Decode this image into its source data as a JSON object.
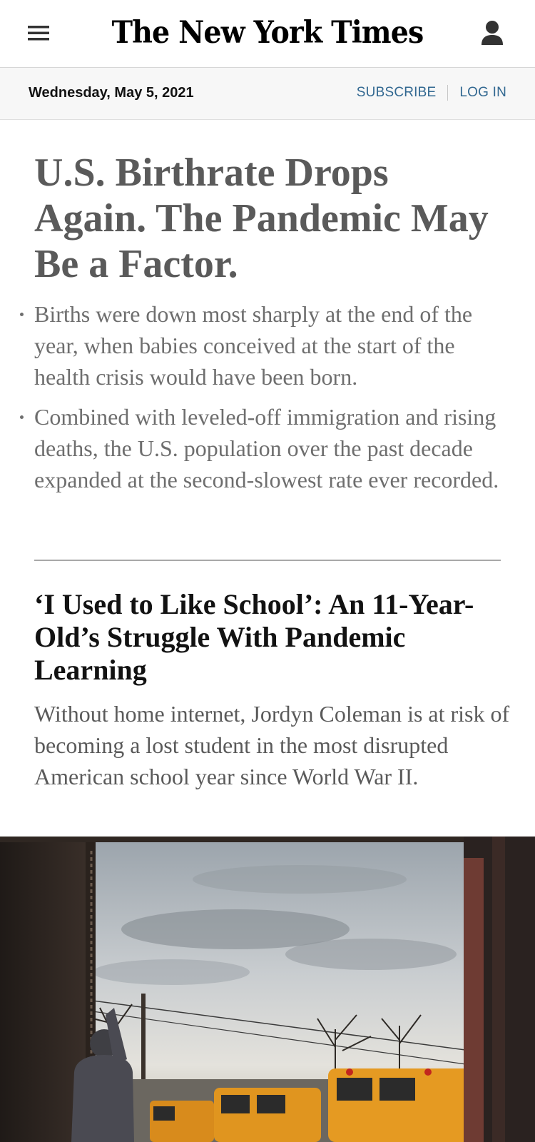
{
  "header": {
    "logo": "The New York Times",
    "menu_icon": "hamburger-menu-icon",
    "account_icon": "user-account-icon"
  },
  "date_bar": {
    "date": "Wednesday, May 5, 2021",
    "subscribe_label": "SUBSCRIBE",
    "login_label": "LOG IN"
  },
  "story1": {
    "headline": "U.S. Birthrate Drops Again. The Pandemic May Be a Factor.",
    "bullets": [
      "Births were down most sharply at the end of the year, when babies conceived at the start of the health crisis would have been born.",
      "Combined with leveled-off immigration and rising deaths, the U.S. population over the past decade expanded at the second-slowest rate ever recorded."
    ]
  },
  "story2": {
    "headline": "‘I Used to Like School’: An 11-Year-Old’s Struggle With Pandemic Learning",
    "summary": "Without home internet, Jordyn Coleman is at risk of becoming a lost student in the most disrupted American school year since World War II."
  },
  "colors": {
    "link_blue": "#326891",
    "headline_gray": "#5a5a5a",
    "date_bar_bg": "#f7f7f7"
  }
}
